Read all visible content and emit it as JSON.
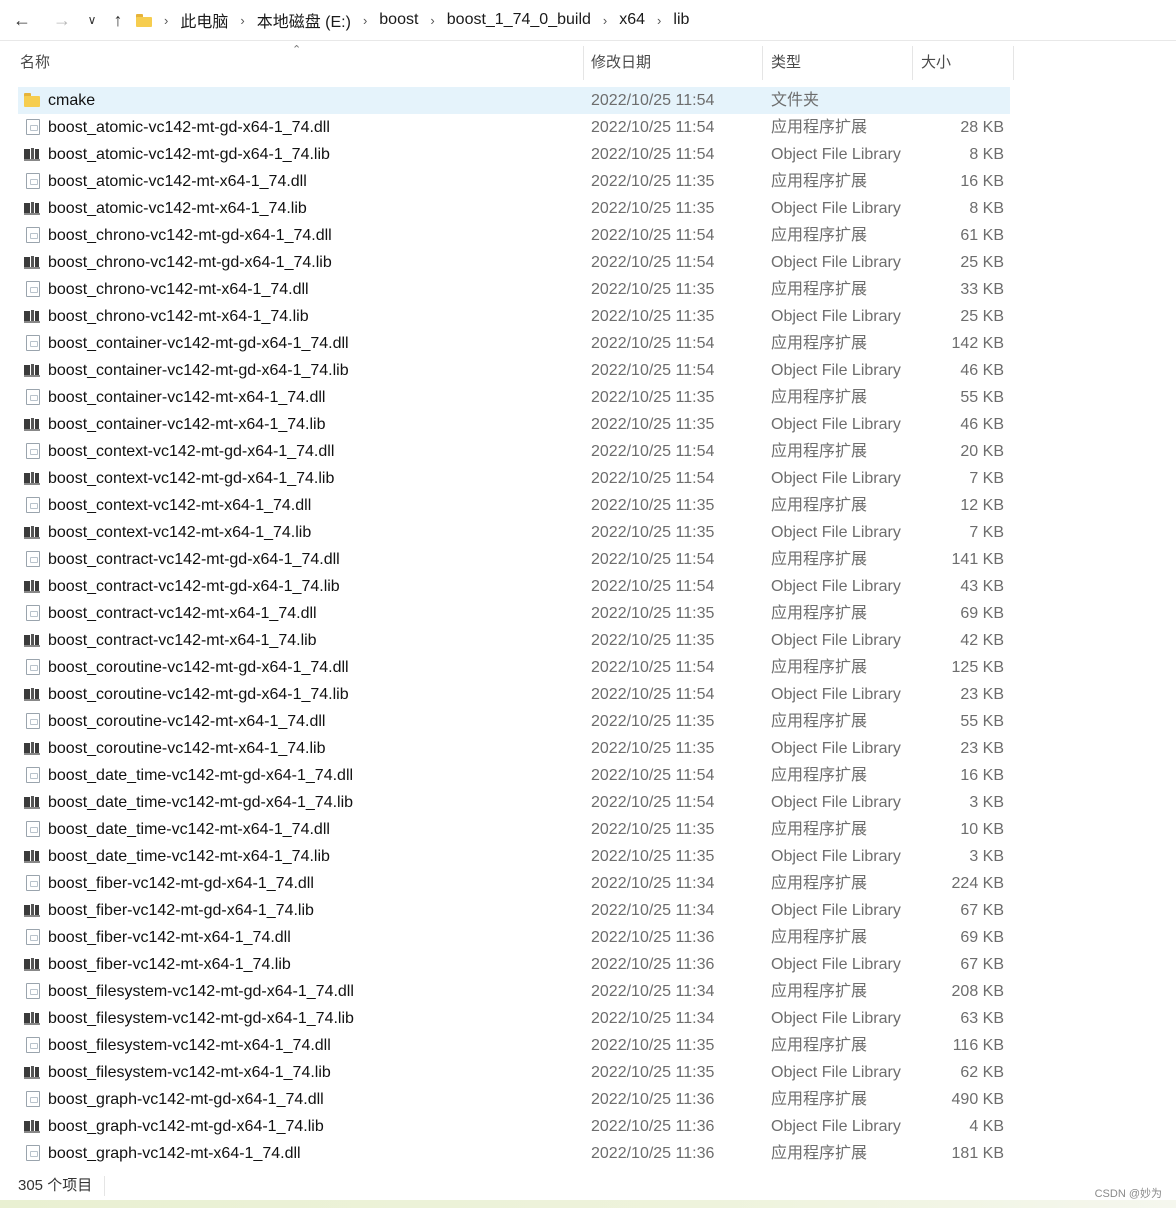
{
  "address_bar": {
    "breadcrumbs": [
      "此电脑",
      "本地磁盘 (E:)",
      "boost",
      "boost_1_74_0_build",
      "x64",
      "lib"
    ]
  },
  "columns": {
    "name": "名称",
    "date": "修改日期",
    "type": "类型",
    "size": "大小"
  },
  "files": [
    {
      "name": "cmake",
      "date": "2022/10/25 11:54",
      "type": "文件夹",
      "size": "",
      "icon": "folder-icon"
    },
    {
      "name": "boost_atomic-vc142-mt-gd-x64-1_74.dll",
      "date": "2022/10/25 11:54",
      "type": "应用程序扩展",
      "size": "28 KB",
      "icon": "dll-icon"
    },
    {
      "name": "boost_atomic-vc142-mt-gd-x64-1_74.lib",
      "date": "2022/10/25 11:54",
      "type": "Object File Library",
      "size": "8 KB",
      "icon": "lib-icon"
    },
    {
      "name": "boost_atomic-vc142-mt-x64-1_74.dll",
      "date": "2022/10/25 11:35",
      "type": "应用程序扩展",
      "size": "16 KB",
      "icon": "dll-icon"
    },
    {
      "name": "boost_atomic-vc142-mt-x64-1_74.lib",
      "date": "2022/10/25 11:35",
      "type": "Object File Library",
      "size": "8 KB",
      "icon": "lib-icon"
    },
    {
      "name": "boost_chrono-vc142-mt-gd-x64-1_74.dll",
      "date": "2022/10/25 11:54",
      "type": "应用程序扩展",
      "size": "61 KB",
      "icon": "dll-icon"
    },
    {
      "name": "boost_chrono-vc142-mt-gd-x64-1_74.lib",
      "date": "2022/10/25 11:54",
      "type": "Object File Library",
      "size": "25 KB",
      "icon": "lib-icon"
    },
    {
      "name": "boost_chrono-vc142-mt-x64-1_74.dll",
      "date": "2022/10/25 11:35",
      "type": "应用程序扩展",
      "size": "33 KB",
      "icon": "dll-icon"
    },
    {
      "name": "boost_chrono-vc142-mt-x64-1_74.lib",
      "date": "2022/10/25 11:35",
      "type": "Object File Library",
      "size": "25 KB",
      "icon": "lib-icon"
    },
    {
      "name": "boost_container-vc142-mt-gd-x64-1_74.dll",
      "date": "2022/10/25 11:54",
      "type": "应用程序扩展",
      "size": "142 KB",
      "icon": "dll-icon"
    },
    {
      "name": "boost_container-vc142-mt-gd-x64-1_74.lib",
      "date": "2022/10/25 11:54",
      "type": "Object File Library",
      "size": "46 KB",
      "icon": "lib-icon"
    },
    {
      "name": "boost_container-vc142-mt-x64-1_74.dll",
      "date": "2022/10/25 11:35",
      "type": "应用程序扩展",
      "size": "55 KB",
      "icon": "dll-icon"
    },
    {
      "name": "boost_container-vc142-mt-x64-1_74.lib",
      "date": "2022/10/25 11:35",
      "type": "Object File Library",
      "size": "46 KB",
      "icon": "lib-icon"
    },
    {
      "name": "boost_context-vc142-mt-gd-x64-1_74.dll",
      "date": "2022/10/25 11:54",
      "type": "应用程序扩展",
      "size": "20 KB",
      "icon": "dll-icon"
    },
    {
      "name": "boost_context-vc142-mt-gd-x64-1_74.lib",
      "date": "2022/10/25 11:54",
      "type": "Object File Library",
      "size": "7 KB",
      "icon": "lib-icon"
    },
    {
      "name": "boost_context-vc142-mt-x64-1_74.dll",
      "date": "2022/10/25 11:35",
      "type": "应用程序扩展",
      "size": "12 KB",
      "icon": "dll-icon"
    },
    {
      "name": "boost_context-vc142-mt-x64-1_74.lib",
      "date": "2022/10/25 11:35",
      "type": "Object File Library",
      "size": "7 KB",
      "icon": "lib-icon"
    },
    {
      "name": "boost_contract-vc142-mt-gd-x64-1_74.dll",
      "date": "2022/10/25 11:54",
      "type": "应用程序扩展",
      "size": "141 KB",
      "icon": "dll-icon"
    },
    {
      "name": "boost_contract-vc142-mt-gd-x64-1_74.lib",
      "date": "2022/10/25 11:54",
      "type": "Object File Library",
      "size": "43 KB",
      "icon": "lib-icon"
    },
    {
      "name": "boost_contract-vc142-mt-x64-1_74.dll",
      "date": "2022/10/25 11:35",
      "type": "应用程序扩展",
      "size": "69 KB",
      "icon": "dll-icon"
    },
    {
      "name": "boost_contract-vc142-mt-x64-1_74.lib",
      "date": "2022/10/25 11:35",
      "type": "Object File Library",
      "size": "42 KB",
      "icon": "lib-icon"
    },
    {
      "name": "boost_coroutine-vc142-mt-gd-x64-1_74.dll",
      "date": "2022/10/25 11:54",
      "type": "应用程序扩展",
      "size": "125 KB",
      "icon": "dll-icon"
    },
    {
      "name": "boost_coroutine-vc142-mt-gd-x64-1_74.lib",
      "date": "2022/10/25 11:54",
      "type": "Object File Library",
      "size": "23 KB",
      "icon": "lib-icon"
    },
    {
      "name": "boost_coroutine-vc142-mt-x64-1_74.dll",
      "date": "2022/10/25 11:35",
      "type": "应用程序扩展",
      "size": "55 KB",
      "icon": "dll-icon"
    },
    {
      "name": "boost_coroutine-vc142-mt-x64-1_74.lib",
      "date": "2022/10/25 11:35",
      "type": "Object File Library",
      "size": "23 KB",
      "icon": "lib-icon"
    },
    {
      "name": "boost_date_time-vc142-mt-gd-x64-1_74.dll",
      "date": "2022/10/25 11:54",
      "type": "应用程序扩展",
      "size": "16 KB",
      "icon": "dll-icon"
    },
    {
      "name": "boost_date_time-vc142-mt-gd-x64-1_74.lib",
      "date": "2022/10/25 11:54",
      "type": "Object File Library",
      "size": "3 KB",
      "icon": "lib-icon"
    },
    {
      "name": "boost_date_time-vc142-mt-x64-1_74.dll",
      "date": "2022/10/25 11:35",
      "type": "应用程序扩展",
      "size": "10 KB",
      "icon": "dll-icon"
    },
    {
      "name": "boost_date_time-vc142-mt-x64-1_74.lib",
      "date": "2022/10/25 11:35",
      "type": "Object File Library",
      "size": "3 KB",
      "icon": "lib-icon"
    },
    {
      "name": "boost_fiber-vc142-mt-gd-x64-1_74.dll",
      "date": "2022/10/25 11:34",
      "type": "应用程序扩展",
      "size": "224 KB",
      "icon": "dll-icon"
    },
    {
      "name": "boost_fiber-vc142-mt-gd-x64-1_74.lib",
      "date": "2022/10/25 11:34",
      "type": "Object File Library",
      "size": "67 KB",
      "icon": "lib-icon"
    },
    {
      "name": "boost_fiber-vc142-mt-x64-1_74.dll",
      "date": "2022/10/25 11:36",
      "type": "应用程序扩展",
      "size": "69 KB",
      "icon": "dll-icon"
    },
    {
      "name": "boost_fiber-vc142-mt-x64-1_74.lib",
      "date": "2022/10/25 11:36",
      "type": "Object File Library",
      "size": "67 KB",
      "icon": "lib-icon"
    },
    {
      "name": "boost_filesystem-vc142-mt-gd-x64-1_74.dll",
      "date": "2022/10/25 11:34",
      "type": "应用程序扩展",
      "size": "208 KB",
      "icon": "dll-icon"
    },
    {
      "name": "boost_filesystem-vc142-mt-gd-x64-1_74.lib",
      "date": "2022/10/25 11:34",
      "type": "Object File Library",
      "size": "63 KB",
      "icon": "lib-icon"
    },
    {
      "name": "boost_filesystem-vc142-mt-x64-1_74.dll",
      "date": "2022/10/25 11:35",
      "type": "应用程序扩展",
      "size": "116 KB",
      "icon": "dll-icon"
    },
    {
      "name": "boost_filesystem-vc142-mt-x64-1_74.lib",
      "date": "2022/10/25 11:35",
      "type": "Object File Library",
      "size": "62 KB",
      "icon": "lib-icon"
    },
    {
      "name": "boost_graph-vc142-mt-gd-x64-1_74.dll",
      "date": "2022/10/25 11:36",
      "type": "应用程序扩展",
      "size": "490 KB",
      "icon": "dll-icon"
    },
    {
      "name": "boost_graph-vc142-mt-gd-x64-1_74.lib",
      "date": "2022/10/25 11:36",
      "type": "Object File Library",
      "size": "4 KB",
      "icon": "lib-icon"
    },
    {
      "name": "boost_graph-vc142-mt-x64-1_74.dll",
      "date": "2022/10/25 11:36",
      "type": "应用程序扩展",
      "size": "181 KB",
      "icon": "dll-icon"
    }
  ],
  "status": {
    "item_count": "305 个项目"
  },
  "watermark": "CSDN @妙为",
  "colors": {
    "selection": "#e5f3fb",
    "folder": "#f6cd4f"
  }
}
